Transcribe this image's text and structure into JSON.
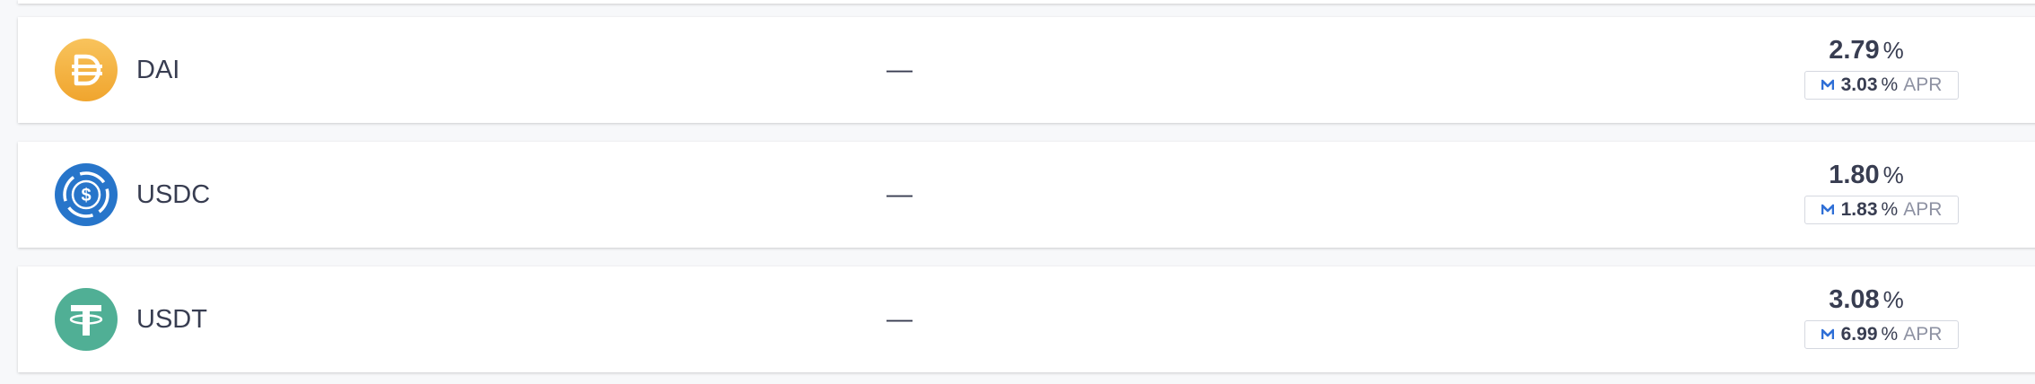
{
  "assets": [
    {
      "symbol": "DAI",
      "icon": "dai-icon",
      "balance": "—",
      "apy": "2.79",
      "apy_unit": "%",
      "reward_apr": "3.03",
      "reward_unit": "%",
      "reward_label": "APR"
    },
    {
      "symbol": "USDC",
      "icon": "usdc-icon",
      "balance": "—",
      "apy": "1.80",
      "apy_unit": "%",
      "reward_apr": "1.83",
      "reward_unit": "%",
      "reward_label": "APR"
    },
    {
      "symbol": "USDT",
      "icon": "usdt-icon",
      "balance": "—",
      "apy": "3.08",
      "apy_unit": "%",
      "reward_apr": "6.99",
      "reward_unit": "%",
      "reward_label": "APR"
    }
  ],
  "colors": {
    "dai": "#f5ac37",
    "usdc": "#2775ca",
    "usdt": "#50af95",
    "reward_icon": "#2f6fd6",
    "text": "#383d51",
    "muted": "#8e92a3"
  }
}
